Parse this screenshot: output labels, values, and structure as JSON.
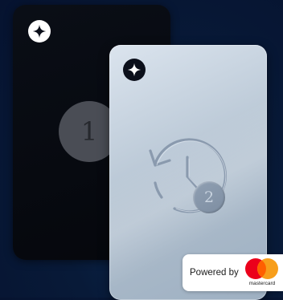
{
  "card_back": {
    "step_number": "1"
  },
  "card_front": {
    "step_number": "2"
  },
  "powered_by": {
    "label": "Powered by",
    "brand_wordmark": "mastercard"
  },
  "icons": {
    "card_logo": "four-point-star-icon",
    "history": "history-clock-icon",
    "brand": "mastercard-logo"
  },
  "colors": {
    "background": "#081a38",
    "card_back": "#05070c",
    "card_front": "#c1cedb",
    "mastercard_red": "#eb001b",
    "mastercard_orange": "#f79e1b",
    "mastercard_overlap": "#ff5f00"
  }
}
